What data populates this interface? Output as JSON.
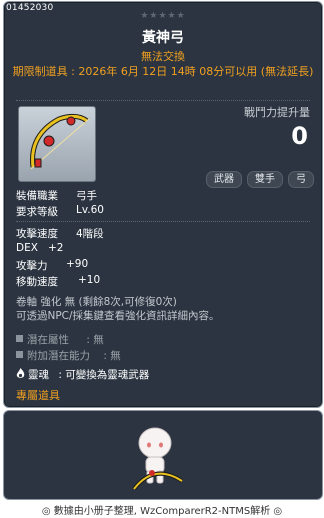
{
  "item": {
    "id": "01452030",
    "stars": "★★★★★",
    "name": "黃神弓",
    "untradeable": "無法交換",
    "limited": "期限制道具 : 2026年 6月 12日 14時 08分可以用 (無法延長)"
  },
  "combat": {
    "label": "戰鬥力提升量",
    "value": "0"
  },
  "tags": [
    "武器",
    "雙手",
    "弓"
  ],
  "requirements": [
    {
      "label": "裝備職業",
      "value": "弓手"
    },
    {
      "label": "要求等級",
      "value": "Lv.60"
    }
  ],
  "stats": [
    {
      "label": "攻擊速度",
      "value": "4階段"
    },
    {
      "label": "DEX",
      "value": "+2"
    },
    {
      "label": "攻擊力",
      "value": "+90"
    },
    {
      "label": "移動速度",
      "value": "+10"
    }
  ],
  "scroll": {
    "line1": "卷軸 強化 無 (剩餘8次,可修復0次)",
    "line2": "可透過NPC/採集鍵查看強化資訊詳細內容。"
  },
  "potential": [
    {
      "label": "潛在屬性",
      "value": ": 無"
    },
    {
      "label": "附加潛在能力",
      "value": ": 無"
    }
  ],
  "soul": {
    "label": "靈魂",
    "text": ": 可變換為靈魂武器"
  },
  "exclusive": "專屬道具",
  "footer": "◎ 數據由小册子整理, WzComparerR2-NTMS解析 ◎"
}
